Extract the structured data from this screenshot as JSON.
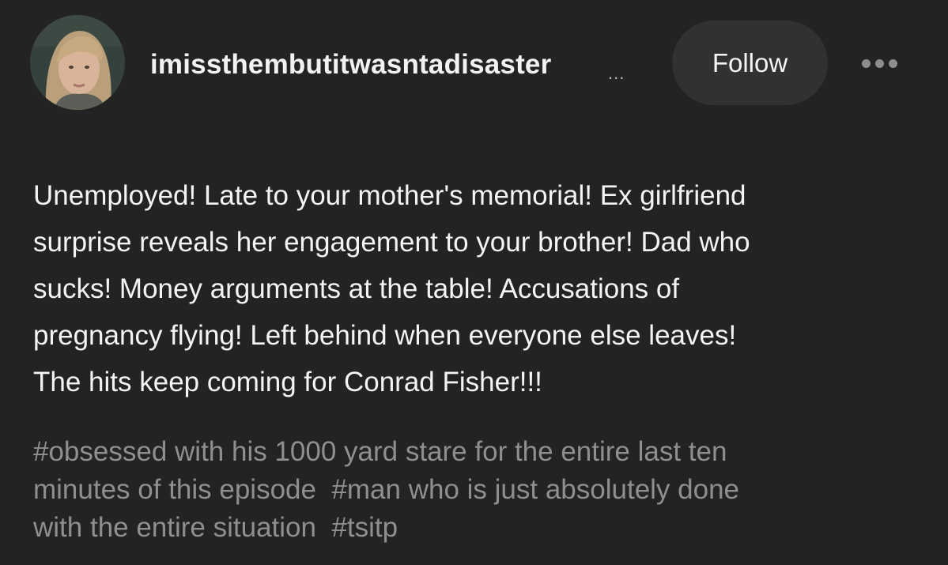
{
  "post": {
    "username": "imissthembutitwasntadisaster",
    "username_truncation": "...",
    "follow_label": "Follow",
    "more_icon": "ellipsis-icon",
    "avatar_icon": "user-avatar",
    "body_lines": [
      "Unemployed! Late to your mother's memorial! Ex girlfriend",
      "surprise reveals her engagement to your brother! Dad who",
      "sucks!  Money arguments at the table! Accusations of",
      "pregnancy flying! Left behind when everyone else leaves!",
      "The hits keep coming for Conrad Fisher!!!"
    ],
    "tags": [
      "#obsessed with his 1000 yard stare for the entire last ten minutes of this episode",
      "#man who is just absolutely done with the entire situation",
      "#tsitp"
    ],
    "tag_lines": [
      [
        "#obsessed with his 1000 yard stare for the entire last ten"
      ],
      [
        "minutes of this episode",
        "#man who is just absolutely done"
      ],
      [
        "with the entire situation",
        "#tsitp"
      ]
    ]
  },
  "colors": {
    "background": "#232323",
    "text_primary": "#f4f4f4",
    "text_tags": "#8f8f8f",
    "follow_button_bg": "#313131"
  }
}
